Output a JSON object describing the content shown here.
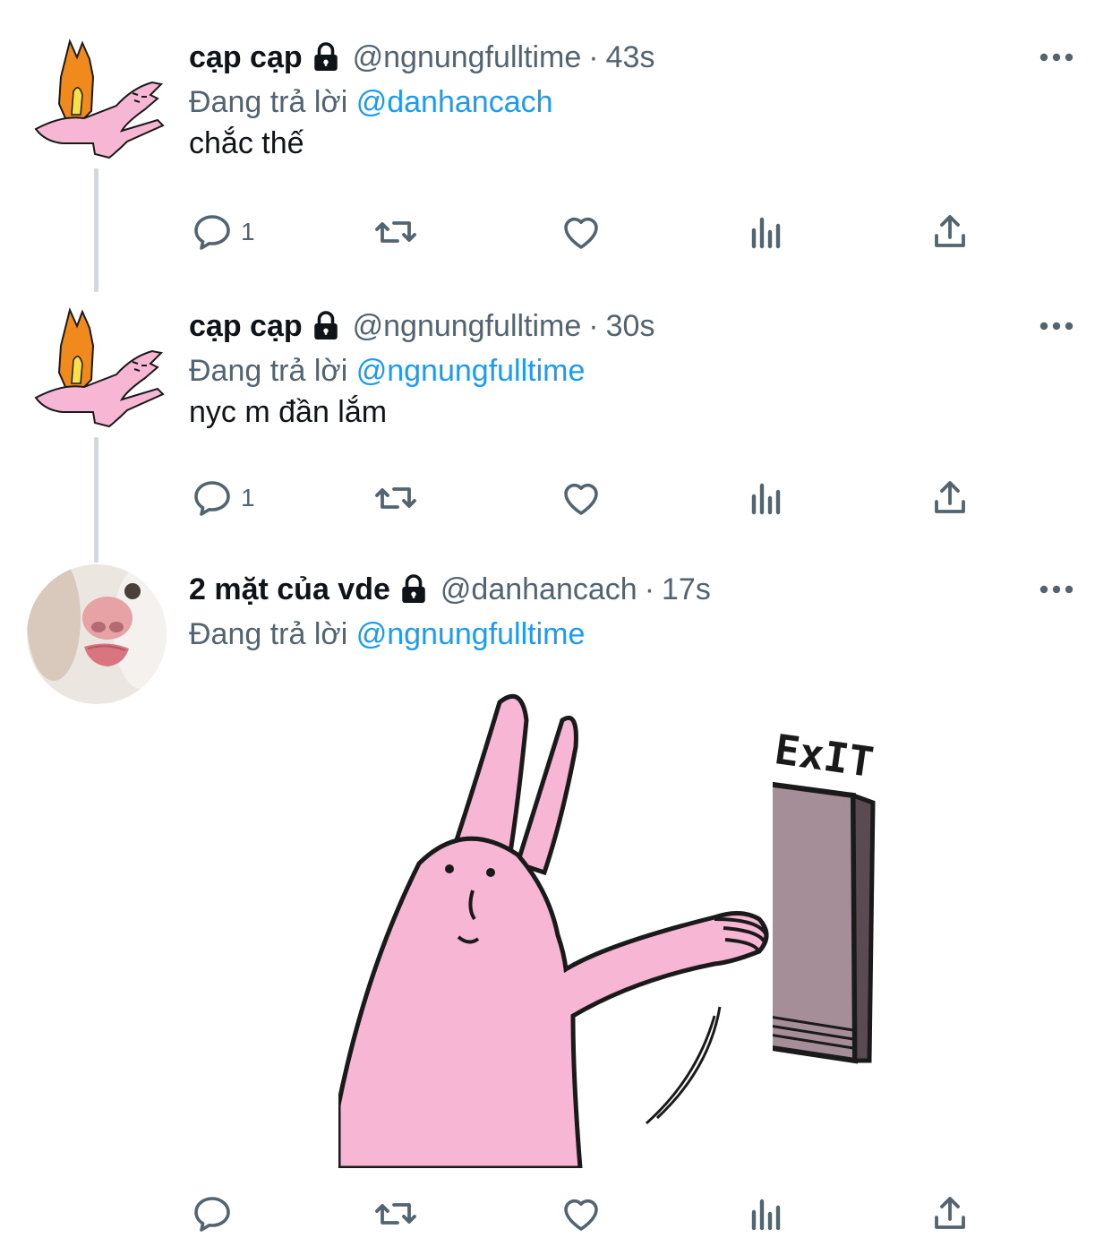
{
  "tweets": [
    {
      "display_name": "cạp cạp",
      "handle": "@ngnungfulltime",
      "separator": "·",
      "time": "43s",
      "reply_prefix": "Đang trả lời",
      "reply_mention": "@danhancach",
      "text": "chắc thế",
      "reply_count": "1",
      "avatar": "pink-rabbit-flame-avatar"
    },
    {
      "display_name": "cạp cạp",
      "handle": "@ngnungfulltime",
      "separator": "·",
      "time": "30s",
      "reply_prefix": "Đang trả lời",
      "reply_mention": "@ngnungfulltime",
      "text": "nyc m đần lắm",
      "reply_count": "1",
      "avatar": "pink-rabbit-flame-avatar"
    },
    {
      "display_name": "2 mặt của vde",
      "handle": "@danhancach",
      "separator": "·",
      "time": "17s",
      "reply_prefix": "Đang trả lời",
      "reply_mention": "@ngnungfulltime",
      "text": "",
      "reply_count": "",
      "avatar": "cat-tongue-avatar",
      "media_alt": "pink rabbit pushing exit door",
      "media_sign_text": "ExIT"
    }
  ],
  "icons": {
    "lock": "lock-icon",
    "more": "more-icon",
    "reply": "reply-icon",
    "retweet": "retweet-icon",
    "like": "like-icon",
    "views": "views-icon",
    "share": "share-icon"
  },
  "colors": {
    "text": "#0f1419",
    "secondary": "#536471",
    "link": "#1d9bf0",
    "thread_line": "#cfd9de",
    "rabbit_pink": "#f7b6d3"
  }
}
